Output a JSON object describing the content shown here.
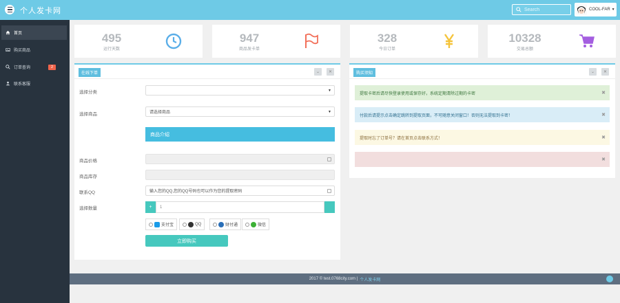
{
  "header": {
    "brand": "个人发卡网",
    "search_placeholder": "Search",
    "user_name": "COOL-FAR",
    "menu_icon": "hamburger-menu-icon"
  },
  "sidebar": {
    "items": [
      {
        "label": "首页",
        "icon": "home-icon",
        "active": true
      },
      {
        "label": "购买商品",
        "icon": "image-icon",
        "active": false
      },
      {
        "label": "订单查询",
        "icon": "search-icon",
        "active": false,
        "badge": "2"
      },
      {
        "label": "联系客服",
        "icon": "user-icon",
        "active": false
      }
    ]
  },
  "stats": [
    {
      "value": "495",
      "label": "运行天数",
      "icon": "clock-icon",
      "color": "#5aaee8"
    },
    {
      "value": "947",
      "label": "商品发卡单",
      "icon": "flag-icon",
      "color": "#f2705a"
    },
    {
      "value": "328",
      "label": "今日订单",
      "icon": "yen-icon",
      "color": "#f5c43b"
    },
    {
      "value": "10328",
      "label": "交易总额",
      "icon": "cart-icon",
      "color": "#a45ee0"
    }
  ],
  "order_panel": {
    "title": "在线下单",
    "category_label": "选择分类",
    "category_value": "",
    "product_label": "选择商品",
    "product_value": "请选择商品",
    "intro_button": "商品介绍",
    "price_label": "商品价格",
    "stock_label": "商品库存",
    "qq_label": "联系QQ",
    "qq_placeholder": "输入您的QQ,您的QQ号码也可以作为您的提取密码",
    "qty_label": "选择数量",
    "qty_value": "1",
    "qty_minus": "+",
    "pay_methods": [
      {
        "label": "支付宝",
        "color": "#1a9be8"
      },
      {
        "label": "QQ",
        "color": "#333333"
      },
      {
        "label": "财付通",
        "color": "#2a6fb8"
      },
      {
        "label": "微信",
        "color": "#3cb035"
      }
    ],
    "submit_label": "立即购买"
  },
  "notice_panel": {
    "title": "购买须知",
    "alerts": [
      {
        "text": "提取卡密后请尽快登录使用或保存好，系统定期清除过期的卡密",
        "bg": "#dff0d8",
        "color": "#3c763d"
      },
      {
        "text": "付款后请提示点击确定跳转到提取页面，不可随意关闭窗口！否则无法提取到卡密！",
        "bg": "#d9edf7",
        "color": "#31708f"
      },
      {
        "text": "提取时忘了订单号？请在首页点击联系方式！",
        "bg": "#fcf8e3",
        "color": "#8a6d3b"
      },
      {
        "text": "",
        "bg": "#f2dede",
        "color": "#a94442"
      }
    ]
  },
  "footer": {
    "copyright": "2017 © test.0768city.com |",
    "link": "个人发卡网"
  }
}
